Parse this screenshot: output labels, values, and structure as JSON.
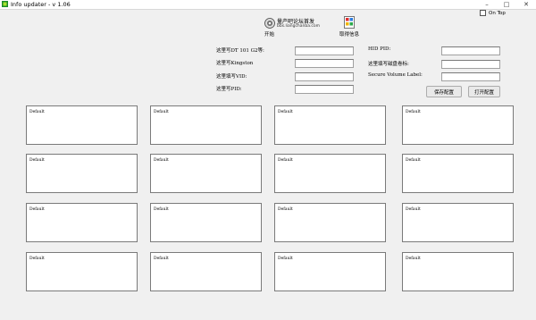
{
  "window": {
    "title": "Info updater - v 1.06",
    "minimize": "–",
    "maximize": "□",
    "close": "✕"
  },
  "ontop": {
    "label": "On Top",
    "checked": false
  },
  "toolbar": {
    "site_name": "量产吧论坛首发",
    "site_url": "bbs.liangchanba.com",
    "start_label": "开始",
    "read_label": "取得信息"
  },
  "form_left": [
    {
      "label": "这里写DT 101 G2等:",
      "value": ""
    },
    {
      "label": "这里写Kingston",
      "value": ""
    },
    {
      "label": "这里填写VID:",
      "value": ""
    },
    {
      "label": "这里写PID:",
      "value": ""
    }
  ],
  "form_right": [
    {
      "label": "HID PID:",
      "value": ""
    },
    {
      "label": "这里填写磁盘卷标:",
      "value": ""
    },
    {
      "label": "Secure Volume Label:",
      "value": ""
    }
  ],
  "buttons": {
    "save": "保存配置",
    "open": "打开配置"
  },
  "panes": [
    "Default",
    "Default",
    "Default",
    "Default",
    "Default",
    "Default",
    "Default",
    "Default",
    "Default",
    "Default",
    "Default",
    "Default",
    "Default",
    "Default",
    "Default",
    "Default"
  ],
  "colors": {
    "background": "#f0f0f0",
    "pane_border": "#7a7a7a"
  }
}
